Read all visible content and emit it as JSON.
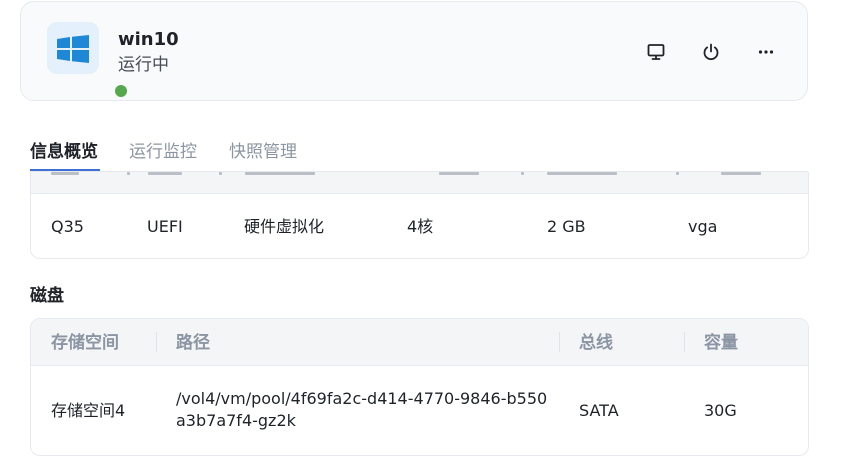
{
  "vm": {
    "name": "win10",
    "status": "运行中",
    "os_icon": "windows-logo-icon",
    "status_color": "#55a84d"
  },
  "actions": [
    {
      "icon": "monitor-icon"
    },
    {
      "icon": "power-icon"
    },
    {
      "icon": "more-icon"
    }
  ],
  "tabs": [
    {
      "label": "信息概览",
      "active": true
    },
    {
      "label": "运行监控",
      "active": false
    },
    {
      "label": "快照管理",
      "active": false
    }
  ],
  "specs": {
    "values": [
      "Q35",
      "UEFI",
      "硬件虚拟化",
      "4核",
      "2 GB",
      "vga"
    ]
  },
  "disk": {
    "title": "磁盘",
    "columns": [
      "存储空间",
      "路径",
      "总线",
      "容量"
    ],
    "rows": [
      {
        "storage": "存储空间4",
        "path": "/vol4/vm/pool/4f69fa2c-d414-4770-9846-b550a3b7a7f4-gz2k",
        "bus": "SATA",
        "capacity": "30G"
      }
    ]
  },
  "colors": {
    "accent": "#3d6fd6",
    "muted_text": "#8c95a3",
    "windows_blue": "#1e88d6"
  }
}
